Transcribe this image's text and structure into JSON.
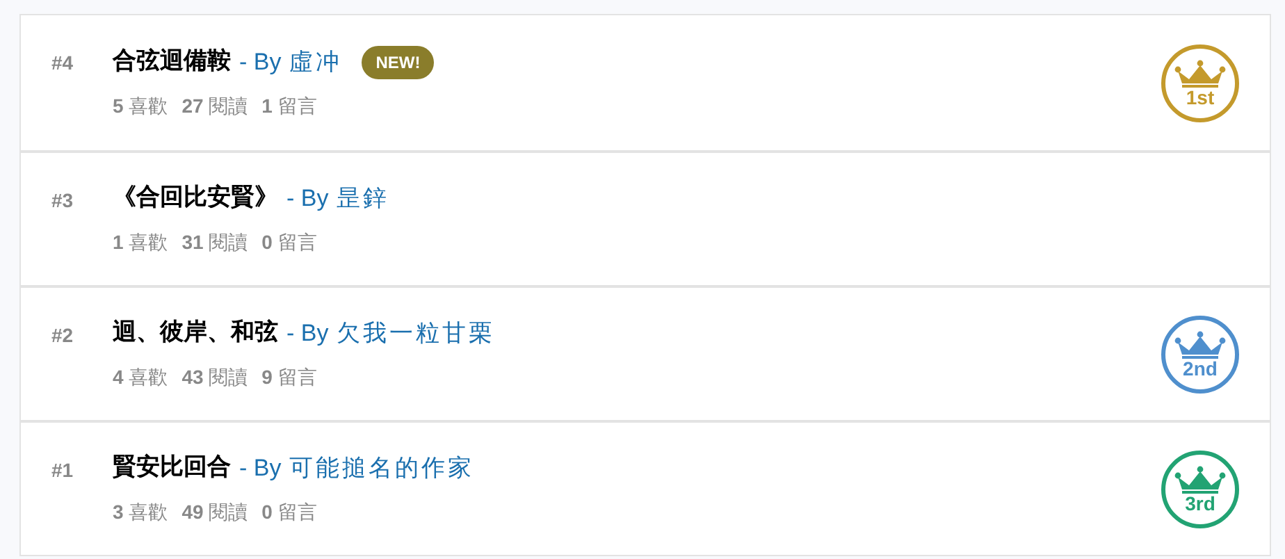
{
  "entries": [
    {
      "rank": "#4",
      "title": "合弦迴備鞍",
      "by": "- By",
      "author": "虛冲",
      "new_badge": "NEW!",
      "stats": [
        {
          "count": "5",
          "label": "喜歡"
        },
        {
          "count": "27",
          "label": "閱讀"
        },
        {
          "count": "1",
          "label": "留言"
        }
      ],
      "award": {
        "label": "1st",
        "color": "#c49a2c"
      }
    },
    {
      "rank": "#3",
      "title": "《合回比安賢》",
      "by": "- By",
      "author": "昰鋅",
      "stats": [
        {
          "count": "1",
          "label": "喜歡"
        },
        {
          "count": "31",
          "label": "閱讀"
        },
        {
          "count": "0",
          "label": "留言"
        }
      ]
    },
    {
      "rank": "#2",
      "title": "迴、彼岸、和弦",
      "by": "- By",
      "author": "欠我一粒甘栗",
      "stats": [
        {
          "count": "4",
          "label": "喜歡"
        },
        {
          "count": "43",
          "label": "閱讀"
        },
        {
          "count": "9",
          "label": "留言"
        }
      ],
      "award": {
        "label": "2nd",
        "color": "#4f8fcd"
      }
    },
    {
      "rank": "#1",
      "title": "賢安比回合",
      "by": "- By",
      "author": "可能搥名的作家",
      "stats": [
        {
          "count": "3",
          "label": "喜歡"
        },
        {
          "count": "49",
          "label": "閱讀"
        },
        {
          "count": "0",
          "label": "留言"
        }
      ],
      "award": {
        "label": "3rd",
        "color": "#22a373"
      }
    }
  ]
}
